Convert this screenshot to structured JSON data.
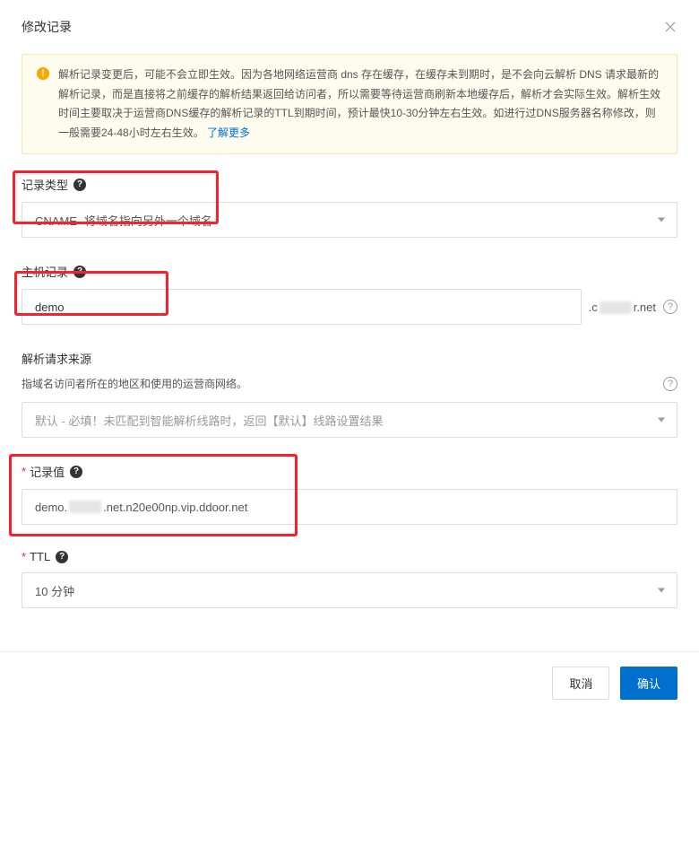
{
  "header": {
    "title": "修改记录"
  },
  "alert": {
    "text": "解析记录变更后，可能不会立即生效。因为各地网络运营商 dns 存在缓存，在缓存未到期时，是不会向云解析 DNS 请求最新的解析记录，而是直接将之前缓存的解析结果返回给访问者，所以需要等待运营商刷新本地缓存后，解析才会实际生效。解析生效时间主要取决于运营商DNS缓存的解析记录的TTL到期时间，预计最快10-30分钟左右生效。如进行过DNS服务器名称修改，则一般需要24-48小时左右生效。",
    "link_label": "了解更多"
  },
  "fields": {
    "record_type": {
      "label": "记录类型",
      "value": "CNAME- 将域名指向另外一个域名"
    },
    "host": {
      "label": "主机记录",
      "value": "demo",
      "suffix_prefix": ".c",
      "suffix_end": "r.net"
    },
    "source": {
      "label": "解析请求来源",
      "desc": "指域名访问者所在的地区和使用的运营商网络。",
      "placeholder": "默认 - 必填！未匹配到智能解析线路时，返回【默认】线路设置结果"
    },
    "record_value": {
      "label": "记录值",
      "value_prefix": "demo.",
      "value_suffix": ".net.n20e00np.vip.ddoor.net"
    },
    "ttl": {
      "label": "TTL",
      "value": "10 分钟"
    }
  },
  "footer": {
    "cancel": "取消",
    "confirm": "确认"
  }
}
